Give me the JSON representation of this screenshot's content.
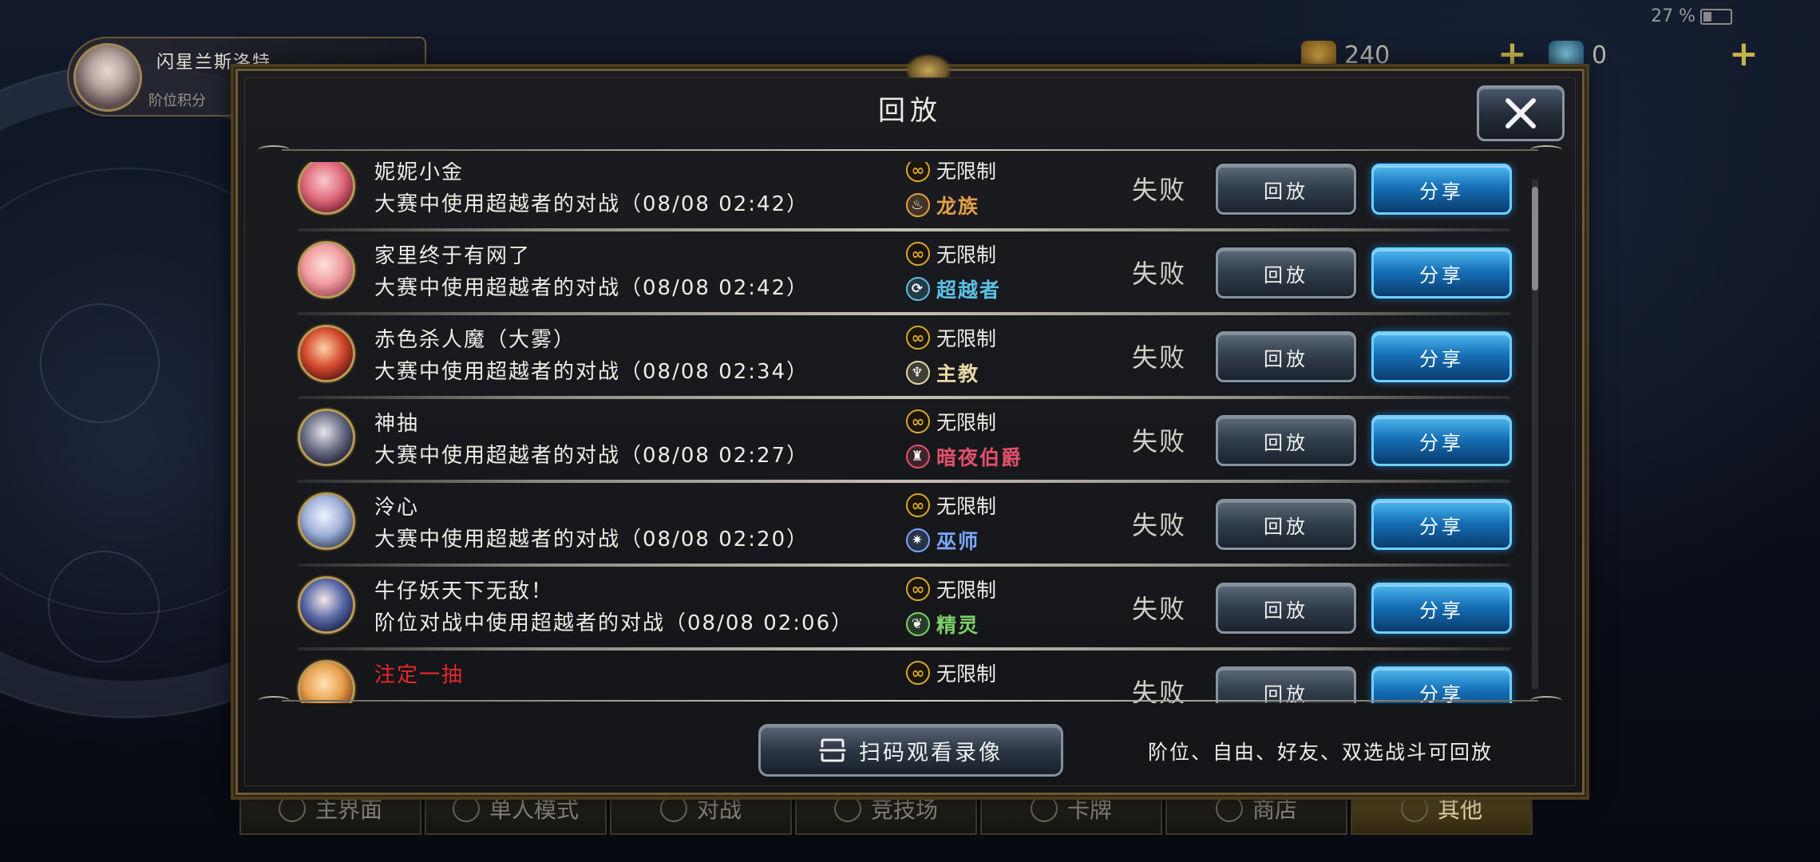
{
  "status": {
    "battery": "27 %"
  },
  "profile": {
    "name": "闪星兰斯洛特",
    "subtitle": "阶位积分"
  },
  "currency": {
    "gold": "240",
    "gems": "0"
  },
  "bottom_nav": [
    "主界面",
    "单人模式",
    "对战",
    "竞技场",
    "卡牌",
    "商店",
    "其他"
  ],
  "modal": {
    "title": "回放",
    "rows": [
      {
        "player": "妮妮小金",
        "desc": "大赛中使用超越者的对战（08/08 02:42）",
        "format": "无限制",
        "class": "龙族",
        "class_color": "#e3a047",
        "result": "失败",
        "replay": "回放",
        "share": "分享",
        "name_color": "normal"
      },
      {
        "player": "家里终于有网了",
        "desc": "大赛中使用超越者的对战（08/08 02:42）",
        "format": "无限制",
        "class": "超越者",
        "class_color": "#5bc0e6",
        "result": "失败",
        "replay": "回放",
        "share": "分享",
        "name_color": "normal"
      },
      {
        "player": "赤色杀人魔（大雾）",
        "desc": "大赛中使用超越者的对战（08/08 02:34）",
        "format": "无限制",
        "class": "主教",
        "class_color": "#e8d7a8",
        "result": "失败",
        "replay": "回放",
        "share": "分享",
        "name_color": "normal"
      },
      {
        "player": "神抽",
        "desc": "大赛中使用超越者的对战（08/08 02:27）",
        "format": "无限制",
        "class": "暗夜伯爵",
        "class_color": "#e2506a",
        "result": "失败",
        "replay": "回放",
        "share": "分享",
        "name_color": "normal"
      },
      {
        "player": "泠心",
        "desc": "大赛中使用超越者的对战（08/08 02:20）",
        "format": "无限制",
        "class": "巫师",
        "class_color": "#7aa6ff",
        "result": "失败",
        "replay": "回放",
        "share": "分享",
        "name_color": "normal"
      },
      {
        "player": "牛仔妖天下无敌！",
        "desc": "阶位对战中使用超越者的对战（08/08 02:06）",
        "format": "无限制",
        "class": "精灵",
        "class_color": "#7ed06a",
        "result": "失败",
        "replay": "回放",
        "share": "分享",
        "name_color": "normal"
      },
      {
        "player": "注定一抽",
        "desc": "",
        "format": "无限制",
        "class": "",
        "class_color": "#ffffff",
        "result": "失败",
        "replay": "回放",
        "share": "分享",
        "name_color": "red"
      }
    ],
    "scan_button": "扫码观看录像",
    "hint": "阶位、自由、好友、双选战斗可回放"
  }
}
